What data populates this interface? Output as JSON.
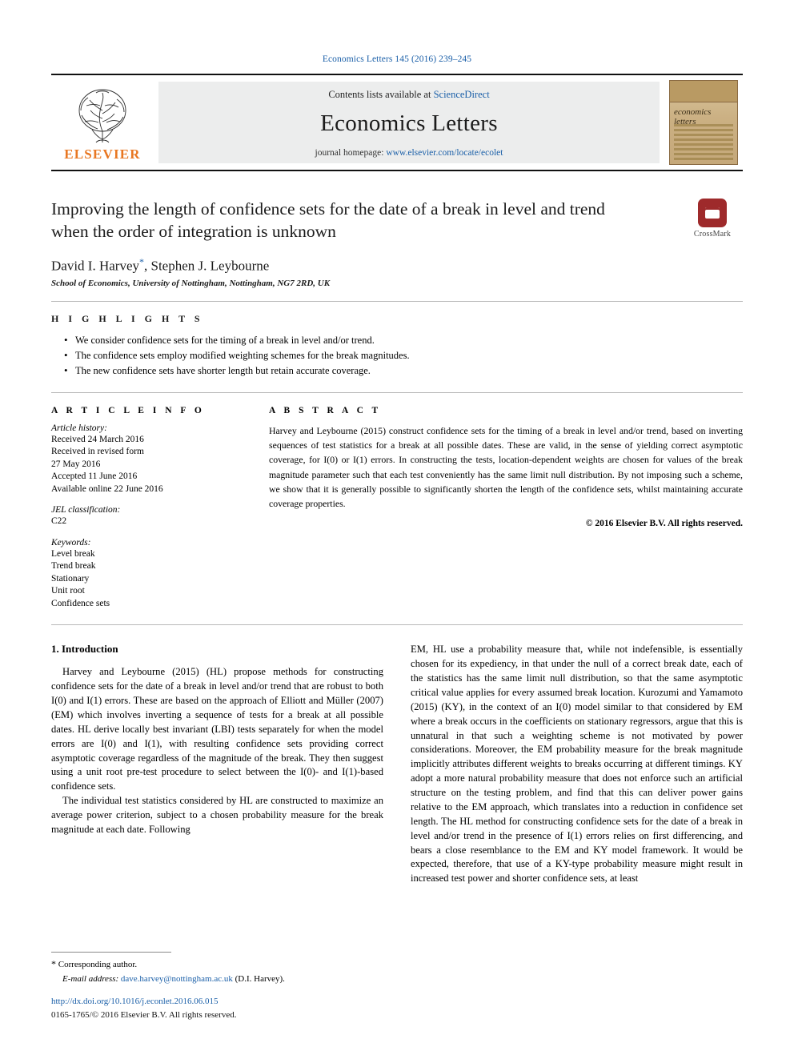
{
  "running_head": "Economics Letters 145 (2016) 239–245",
  "masthead": {
    "contents_prefix": "Contents lists available at",
    "contents_link": "ScienceDirect",
    "journal_title": "Economics Letters",
    "homepage_prefix": "journal homepage:",
    "homepage_link": "www.elsevier.com/locate/ecolet",
    "publisher": "ELSEVIER",
    "cover_title_line1": "economics",
    "cover_title_line2": "letters"
  },
  "article": {
    "title": "Improving the length of confidence sets for the date of a break in level and trend when the order of integration is unknown",
    "crossmark_label": "CrossMark",
    "authors": "David I. Harvey",
    "authors_rest": ", Stephen J. Leybourne",
    "corresponding_marker": "*",
    "affiliation": "School of Economics, University of Nottingham, Nottingham, NG7 2RD, UK"
  },
  "highlights": {
    "heading": "H I G H L I G H T S",
    "items": [
      "We consider confidence sets for the timing of a break in level and/or trend.",
      "The confidence sets employ modified weighting schemes for the break magnitudes.",
      "The new confidence sets have shorter length but retain accurate coverage."
    ]
  },
  "article_info": {
    "heading": "A R T I C L E     I N F O",
    "history_label": "Article history:",
    "history": [
      "Received 24 March 2016",
      "Received in revised form",
      "27 May 2016",
      "Accepted 11 June 2016",
      "Available online 22 June 2016"
    ],
    "jel_label": "JEL classification:",
    "jel_values": [
      "C22"
    ],
    "keywords_label": "Keywords:",
    "keywords": [
      "Level break",
      "Trend break",
      "Stationary",
      "Unit root",
      "Confidence sets"
    ]
  },
  "abstract": {
    "heading": "A B S T R A C T",
    "text": "Harvey and Leybourne (2015) construct confidence sets for the timing of a break in level and/or trend, based on inverting sequences of test statistics for a break at all possible dates. These are valid, in the sense of yielding correct asymptotic coverage, for I(0) or I(1) errors. In constructing the tests, location-dependent weights are chosen for values of the break magnitude parameter such that each test conveniently has the same limit null distribution. By not imposing such a scheme, we show that it is generally possible to significantly shorten the length of the confidence sets, whilst maintaining accurate coverage properties.",
    "copyright": "© 2016 Elsevier B.V. All rights reserved."
  },
  "body": {
    "section_number_title": "1.  Introduction",
    "left_paragraphs": [
      "Harvey and Leybourne (2015) (HL) propose methods for constructing confidence sets for the date of a break in level and/or trend that are robust to both I(0) and I(1) errors. These are based on the approach of Elliott and Müller (2007) (EM) which involves inverting a sequence of tests for a break at all possible dates. HL derive locally best invariant (LBI) tests separately for when the model errors are I(0) and I(1), with resulting confidence sets providing correct asymptotic coverage regardless of the magnitude of the break. They then suggest using a unit root pre-test procedure to select between the I(0)- and I(1)-based confidence sets.",
      "The individual test statistics considered by HL are constructed to maximize an average power criterion, subject to a chosen probability measure for the break magnitude at each date. Following"
    ],
    "right_paragraphs": [
      "EM, HL use a probability measure that, while not indefensible, is essentially chosen for its expediency, in that under the null of a correct break date, each of the statistics has the same limit null distribution, so that the same asymptotic critical value applies for every assumed break location. Kurozumi and Yamamoto (2015) (KY), in the context of an I(0) model similar to that considered by EM where a break occurs in the coefficients on stationary regressors, argue that this is unnatural in that such a weighting scheme is not motivated by power considerations. Moreover, the EM probability measure for the break magnitude implicitly attributes different weights to breaks occurring at different timings. KY adopt a more natural probability measure that does not enforce such an artificial structure on the testing problem, and find that this can deliver power gains relative to the EM approach, which translates into a reduction in confidence set length. The HL method for constructing confidence sets for the date of a break in level and/or trend in the presence of I(1) errors relies on first differencing, and bears a close resemblance to the EM and KY model framework. It would be expected, therefore, that use of a KY-type probability measure might result in increased test power and shorter confidence sets, at least"
    ]
  },
  "footnotes": {
    "corresponding_marker": "*",
    "corresponding_text": "Corresponding author.",
    "email_label": "E-mail address:",
    "email": "dave.harvey@nottingham.ac.uk",
    "email_owner": "(D.I. Harvey).",
    "doi": "http://dx.doi.org/10.1016/j.econlet.2016.06.015",
    "issn": "0165-1765/© 2016 Elsevier B.V. All rights reserved."
  },
  "colors": {
    "link_blue": "#1a5fa8",
    "elsevier_orange": "#E87722",
    "crossmark_red": "#9e2a2b",
    "masthead_gray": "#eceded"
  }
}
